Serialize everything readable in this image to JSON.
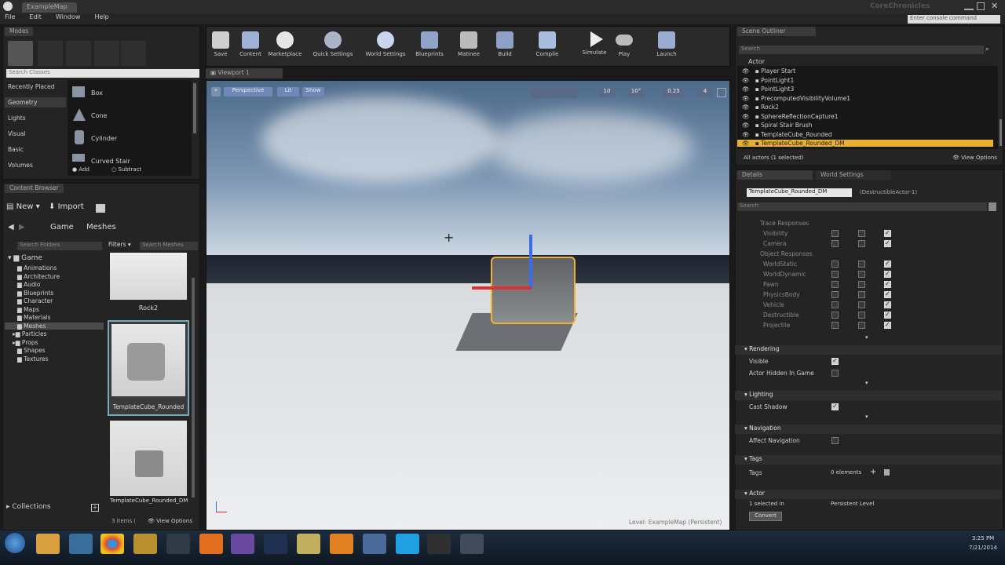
{
  "window": {
    "title": "ExampleMap",
    "brand": "CoreChronicles",
    "console_placeholder": "Enter console command"
  },
  "menu": [
    "File",
    "Edit",
    "Window",
    "Help"
  ],
  "modes": {
    "tab": "Modes",
    "search_placeholder": "Search Classes",
    "categories": [
      "Recently Placed",
      "Geometry",
      "Lights",
      "Visual",
      "Basic",
      "Volumes"
    ],
    "items": [
      "Box",
      "Cone",
      "Cylinder",
      "Curved Stair"
    ],
    "add": "Add",
    "subtract": "Subtract"
  },
  "content_browser": {
    "tab": "Content Browser",
    "new": "New",
    "import": "Import",
    "path": [
      "Game",
      "Meshes"
    ],
    "search_folders": "Search Folders",
    "filters": "Filters",
    "search_meshes": "Search Meshes",
    "tree_root": "Game",
    "folders": [
      "Animations",
      "Architecture",
      "Audio",
      "Blueprints",
      "Character",
      "Maps",
      "Materials",
      "Meshes",
      "Particles",
      "Props",
      "Shapes",
      "Textures"
    ],
    "assets": [
      "Rock2",
      "TemplateCube_Rounded",
      "TemplateCube_Rounded_DM"
    ],
    "collections": "Collections",
    "item_count": "3 items (",
    "view_options": "View Options"
  },
  "toolbar": [
    "Save",
    "Content",
    "Marketplace",
    "Quick Settings",
    "World Settings",
    "Blueprints",
    "Matinee",
    "Build",
    "Compile",
    "Simulate",
    "Play",
    "Launch"
  ],
  "viewport": {
    "tab": "Viewport 1",
    "perspective": "Perspective",
    "lit": "Lit",
    "show": "Show",
    "grid": "10",
    "angle": "10°",
    "scale": "0.25",
    "speed": "4",
    "level_label": "Level:",
    "level_name": "ExampleMap (Persistent)"
  },
  "outliner": {
    "tab": "Scene Outliner",
    "search": "Search",
    "column": "Actor",
    "actors": [
      "Player Start",
      "PointLight1",
      "PointLight3",
      "PrecomputedVisibilityVolume1",
      "Rock2",
      "SphereReflectionCapture1",
      "Spiral Stair Brush",
      "TemplateCube_Rounded",
      "TemplateCube_Rounded_DM"
    ],
    "count": "All actors (1 selected)",
    "view_options": "View Options"
  },
  "details": {
    "tab": "Details",
    "tab2": "World Settings",
    "name": "TemplateCube_Rounded_DM",
    "type": "(DestructibleActor-1)",
    "search": "Search",
    "collision_rows": [
      "Trace Responses",
      "Visibility",
      "Camera",
      "Object Responses",
      "WorldStatic",
      "WorldDynamic",
      "Pawn",
      "PhysicsBody",
      "Vehicle",
      "Destructible",
      "Projectile"
    ],
    "rendering": "Rendering",
    "visible": "Visible",
    "actor_hidden": "Actor Hidden In Game",
    "lighting": "Lighting",
    "cast_shadow": "Cast Shadow",
    "navigation": "Navigation",
    "affect_nav": "Affect Navigation",
    "tags": "Tags",
    "tags_label": "Tags",
    "tags_value": "0 elements",
    "actor": "Actor",
    "selected_in": "1 selected in",
    "level": "Persistent Level",
    "convert": "Convert"
  },
  "taskbar": {
    "time": "3:25 PM",
    "date": "7/21/2014"
  }
}
